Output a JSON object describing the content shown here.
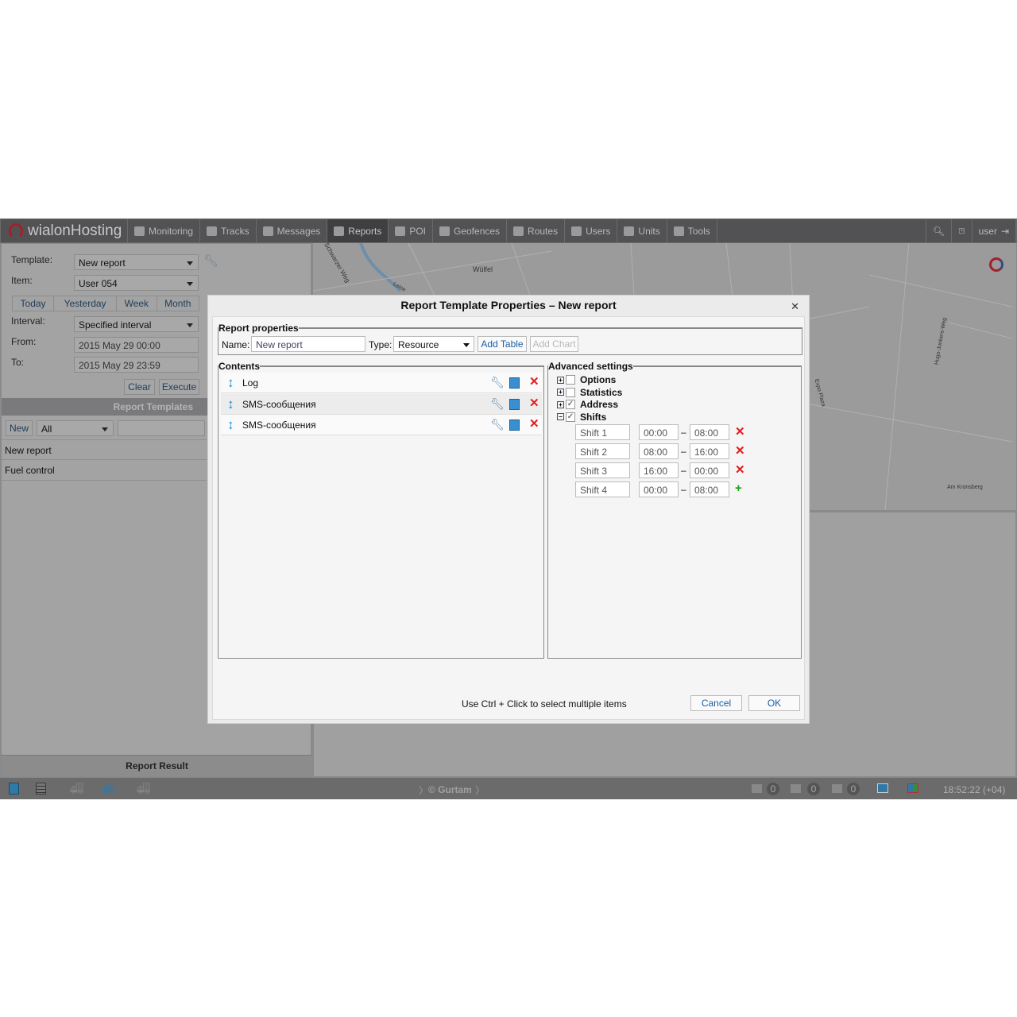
{
  "app": {
    "logo": "wialonHosting",
    "nav": [
      {
        "label": "Monitoring",
        "icon": "globe-icon"
      },
      {
        "label": "Tracks",
        "icon": "tracks-icon"
      },
      {
        "label": "Messages",
        "icon": "messages-icon"
      },
      {
        "label": "Reports",
        "icon": "reports-icon",
        "active": true
      },
      {
        "label": "POI",
        "icon": "poi-icon"
      },
      {
        "label": "Geofences",
        "icon": "geofences-icon"
      },
      {
        "label": "Routes",
        "icon": "routes-icon"
      },
      {
        "label": "Users",
        "icon": "users-icon"
      },
      {
        "label": "Units",
        "icon": "units-icon"
      },
      {
        "label": "Tools",
        "icon": "tools-icon"
      }
    ],
    "user": "user"
  },
  "left": {
    "template_label": "Template:",
    "template_value": "New report",
    "item_label": "Item:",
    "item_value": "User 054",
    "periods": [
      "Today",
      "Yesterday",
      "Week",
      "Month"
    ],
    "interval_label": "Interval:",
    "interval_value": "Specified interval",
    "from_label": "From:",
    "from_value": "2015 May 29 00:00",
    "to_label": "To:",
    "to_value": "2015 May 29 23:59",
    "clear": "Clear",
    "execute": "Execute",
    "templates_header": "Report Templates",
    "new": "New",
    "filter_value": "All",
    "templates": [
      "New report",
      "Fuel control"
    ],
    "result_header": "Report Result"
  },
  "map": {
    "labels": [
      "Wülfel",
      "Schwarzer Weg",
      "Expo Plaza",
      "Am Kronsberg",
      "Hugo-Junkers-Weg",
      "Leine"
    ]
  },
  "status": {
    "copyright": "© Gurtam",
    "counters": [
      "0",
      "0",
      "0"
    ],
    "time": "18:52:22 (+04)"
  },
  "dialog": {
    "title": "Report Template Properties – New report",
    "props_legend": "Report properties",
    "name_label": "Name:",
    "name_value": "New report",
    "type_label": "Type:",
    "type_value": "Resource",
    "add_table": "Add Table",
    "add_chart": "Add Chart",
    "contents_legend": "Contents",
    "contents": [
      "Log",
      "SMS-сообщения",
      "SMS-сообщения"
    ],
    "adv_legend": "Advanced settings",
    "adv": [
      {
        "label": "Options",
        "checked": false,
        "expanded": false
      },
      {
        "label": "Statistics",
        "checked": false,
        "expanded": false
      },
      {
        "label": "Address",
        "checked": true,
        "expanded": false
      },
      {
        "label": "Shifts",
        "checked": true,
        "expanded": true
      }
    ],
    "shifts": [
      {
        "name": "Shift 1",
        "from": "00:00",
        "to": "08:00",
        "action": "remove"
      },
      {
        "name": "Shift 2",
        "from": "08:00",
        "to": "16:00",
        "action": "remove"
      },
      {
        "name": "Shift 3",
        "from": "16:00",
        "to": "00:00",
        "action": "remove"
      },
      {
        "name": "Shift 4",
        "from": "00:00",
        "to": "08:00",
        "action": "add"
      }
    ],
    "hint": "Use Ctrl + Click to select multiple items",
    "cancel": "Cancel",
    "ok": "OK"
  }
}
